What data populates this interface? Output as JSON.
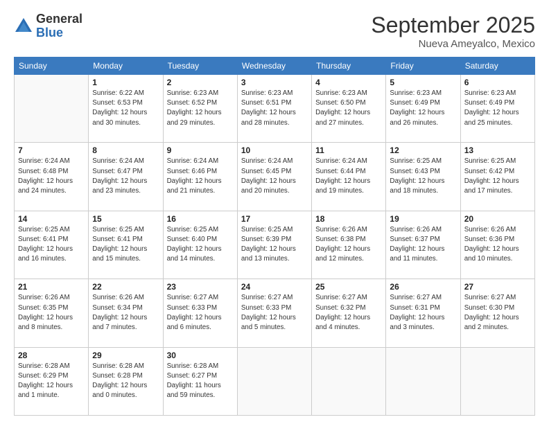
{
  "header": {
    "logo_general": "General",
    "logo_blue": "Blue",
    "month_title": "September 2025",
    "location": "Nueva Ameyalco, Mexico"
  },
  "days_of_week": [
    "Sunday",
    "Monday",
    "Tuesday",
    "Wednesday",
    "Thursday",
    "Friday",
    "Saturday"
  ],
  "weeks": [
    [
      {
        "day": "",
        "info": ""
      },
      {
        "day": "1",
        "info": "Sunrise: 6:22 AM\nSunset: 6:53 PM\nDaylight: 12 hours\nand 30 minutes."
      },
      {
        "day": "2",
        "info": "Sunrise: 6:23 AM\nSunset: 6:52 PM\nDaylight: 12 hours\nand 29 minutes."
      },
      {
        "day": "3",
        "info": "Sunrise: 6:23 AM\nSunset: 6:51 PM\nDaylight: 12 hours\nand 28 minutes."
      },
      {
        "day": "4",
        "info": "Sunrise: 6:23 AM\nSunset: 6:50 PM\nDaylight: 12 hours\nand 27 minutes."
      },
      {
        "day": "5",
        "info": "Sunrise: 6:23 AM\nSunset: 6:49 PM\nDaylight: 12 hours\nand 26 minutes."
      },
      {
        "day": "6",
        "info": "Sunrise: 6:23 AM\nSunset: 6:49 PM\nDaylight: 12 hours\nand 25 minutes."
      }
    ],
    [
      {
        "day": "7",
        "info": "Sunrise: 6:24 AM\nSunset: 6:48 PM\nDaylight: 12 hours\nand 24 minutes."
      },
      {
        "day": "8",
        "info": "Sunrise: 6:24 AM\nSunset: 6:47 PM\nDaylight: 12 hours\nand 23 minutes."
      },
      {
        "day": "9",
        "info": "Sunrise: 6:24 AM\nSunset: 6:46 PM\nDaylight: 12 hours\nand 21 minutes."
      },
      {
        "day": "10",
        "info": "Sunrise: 6:24 AM\nSunset: 6:45 PM\nDaylight: 12 hours\nand 20 minutes."
      },
      {
        "day": "11",
        "info": "Sunrise: 6:24 AM\nSunset: 6:44 PM\nDaylight: 12 hours\nand 19 minutes."
      },
      {
        "day": "12",
        "info": "Sunrise: 6:25 AM\nSunset: 6:43 PM\nDaylight: 12 hours\nand 18 minutes."
      },
      {
        "day": "13",
        "info": "Sunrise: 6:25 AM\nSunset: 6:42 PM\nDaylight: 12 hours\nand 17 minutes."
      }
    ],
    [
      {
        "day": "14",
        "info": "Sunrise: 6:25 AM\nSunset: 6:41 PM\nDaylight: 12 hours\nand 16 minutes."
      },
      {
        "day": "15",
        "info": "Sunrise: 6:25 AM\nSunset: 6:41 PM\nDaylight: 12 hours\nand 15 minutes."
      },
      {
        "day": "16",
        "info": "Sunrise: 6:25 AM\nSunset: 6:40 PM\nDaylight: 12 hours\nand 14 minutes."
      },
      {
        "day": "17",
        "info": "Sunrise: 6:25 AM\nSunset: 6:39 PM\nDaylight: 12 hours\nand 13 minutes."
      },
      {
        "day": "18",
        "info": "Sunrise: 6:26 AM\nSunset: 6:38 PM\nDaylight: 12 hours\nand 12 minutes."
      },
      {
        "day": "19",
        "info": "Sunrise: 6:26 AM\nSunset: 6:37 PM\nDaylight: 12 hours\nand 11 minutes."
      },
      {
        "day": "20",
        "info": "Sunrise: 6:26 AM\nSunset: 6:36 PM\nDaylight: 12 hours\nand 10 minutes."
      }
    ],
    [
      {
        "day": "21",
        "info": "Sunrise: 6:26 AM\nSunset: 6:35 PM\nDaylight: 12 hours\nand 8 minutes."
      },
      {
        "day": "22",
        "info": "Sunrise: 6:26 AM\nSunset: 6:34 PM\nDaylight: 12 hours\nand 7 minutes."
      },
      {
        "day": "23",
        "info": "Sunrise: 6:27 AM\nSunset: 6:33 PM\nDaylight: 12 hours\nand 6 minutes."
      },
      {
        "day": "24",
        "info": "Sunrise: 6:27 AM\nSunset: 6:33 PM\nDaylight: 12 hours\nand 5 minutes."
      },
      {
        "day": "25",
        "info": "Sunrise: 6:27 AM\nSunset: 6:32 PM\nDaylight: 12 hours\nand 4 minutes."
      },
      {
        "day": "26",
        "info": "Sunrise: 6:27 AM\nSunset: 6:31 PM\nDaylight: 12 hours\nand 3 minutes."
      },
      {
        "day": "27",
        "info": "Sunrise: 6:27 AM\nSunset: 6:30 PM\nDaylight: 12 hours\nand 2 minutes."
      }
    ],
    [
      {
        "day": "28",
        "info": "Sunrise: 6:28 AM\nSunset: 6:29 PM\nDaylight: 12 hours\nand 1 minute."
      },
      {
        "day": "29",
        "info": "Sunrise: 6:28 AM\nSunset: 6:28 PM\nDaylight: 12 hours\nand 0 minutes."
      },
      {
        "day": "30",
        "info": "Sunrise: 6:28 AM\nSunset: 6:27 PM\nDaylight: 11 hours\nand 59 minutes."
      },
      {
        "day": "",
        "info": ""
      },
      {
        "day": "",
        "info": ""
      },
      {
        "day": "",
        "info": ""
      },
      {
        "day": "",
        "info": ""
      }
    ]
  ]
}
